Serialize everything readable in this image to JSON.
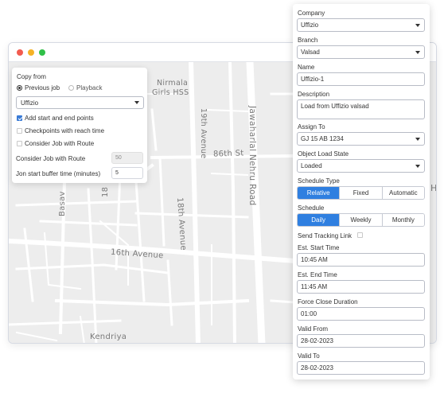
{
  "map": {
    "labels": {
      "nirmala": "Nirmala",
      "girls_hss": "Girls HSS",
      "avenue_19th": "19th Avenue",
      "jawaharlal": "Jawaharlal Nehru Road",
      "st_86th": "86th St",
      "avenue_18th": "18th Avenue",
      "avenue_16th": "16th Avenue",
      "basav": "Basav",
      "kendriya": "Kendriya",
      "edge_18": "18",
      "edge_h": "H"
    }
  },
  "copy_from": {
    "title": "Copy from",
    "radio_previous": "Previous job",
    "radio_playback": "Playback",
    "company_select": "Uffizio",
    "chk_start_end": "Add start and end points",
    "chk_checkpoints": "Checkpoints with reach time",
    "chk_consider": "Consider Job with Route",
    "consider_route_label": "Consider Job with Route",
    "consider_route_value": "50",
    "buffer_label": "Jon start buffer time (minutes)",
    "buffer_value": "5"
  },
  "form": {
    "company_label": "Company",
    "company_value": "Uffizio",
    "branch_label": "Branch",
    "branch_value": "Valsad",
    "name_label": "Name",
    "name_value": "Uffizio-1",
    "description_label": "Description",
    "description_value": "Load from Uffizio valsad",
    "assign_label": "Assign To",
    "assign_value": "GJ 15 AB 1234",
    "load_state_label": "Object Load State",
    "load_state_value": "Loaded",
    "schedule_type_label": "Schedule Type",
    "schedule_type_options": [
      "Relative",
      "Fixed",
      "Automatic"
    ],
    "schedule_label": "Schedule",
    "schedule_options": [
      "Daily",
      "Weekly",
      "Monthly"
    ],
    "send_tracking_label": "Send Tracking Link",
    "start_time_label": "Est. Start Time",
    "start_time_value": "10:45 AM",
    "end_time_label": "Est. End Time",
    "end_time_value": "11:45 AM",
    "force_close_label": "Force Close Duration",
    "force_close_value": "01:00",
    "valid_from_label": "Valid From",
    "valid_from_value": "28-02-2023",
    "valid_to_label": "Valid To",
    "valid_to_value": "28-02-2023"
  },
  "colors": {
    "accent": "#2f7fe0",
    "map_bg": "#ededed",
    "road": "#ffffff"
  }
}
